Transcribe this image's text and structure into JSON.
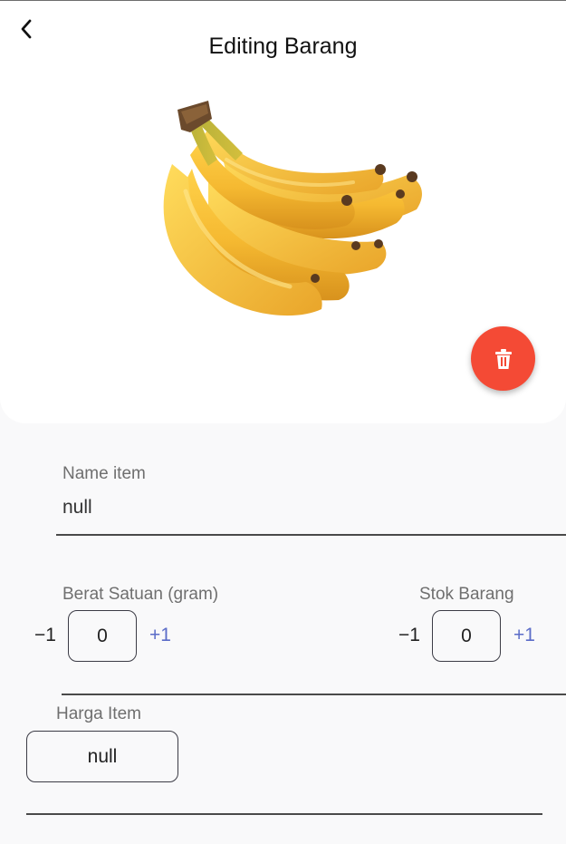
{
  "header": {
    "title": "Editing Barang",
    "back_icon": "chevron-left-icon",
    "image_alt": "banana bunch"
  },
  "delete_button": {
    "icon": "trash-icon",
    "color": "#f44a35"
  },
  "form": {
    "name": {
      "label": "Name item",
      "value": "null"
    },
    "berat": {
      "label": "Berat Satuan (gram)",
      "minus": "−1",
      "value": "0",
      "plus": "+1"
    },
    "stok": {
      "label": "Stok Barang",
      "minus": "−1",
      "value": "0",
      "plus": "+1"
    },
    "harga": {
      "label": "Harga Item",
      "value": "null"
    }
  },
  "colors": {
    "accent": "#5b6cc8",
    "danger": "#f44a35",
    "card": "#ffffff",
    "background": "#f9f9fa"
  }
}
